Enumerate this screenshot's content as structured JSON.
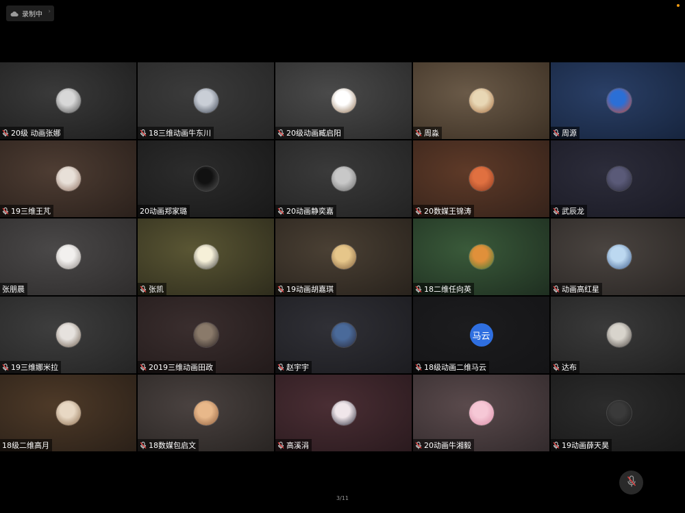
{
  "recording": {
    "label": "录制中",
    "icon": "cloud-icon"
  },
  "status_dot_color": "#f39c12",
  "page_indicator": "3/11",
  "mic_button": {
    "icon": "mic-muted-icon"
  },
  "participants": [
    {
      "name": "20级 动画张娜",
      "muted": true,
      "bg": [
        "#3a3a3a",
        "#1e1e1e"
      ],
      "avatar": [
        "#d8d8d8",
        "#4a4a4a"
      ]
    },
    {
      "name": "18三维动画牛东川",
      "muted": true,
      "bg": [
        "#3b3b3b",
        "#262626"
      ],
      "avatar": [
        "#c9ced6",
        "#3a4250"
      ]
    },
    {
      "name": "20级动画臧启阳",
      "muted": true,
      "bg": [
        "#4a4a4a",
        "#2a2a2a"
      ],
      "avatar": [
        "#ffffff",
        "#8a6a4a"
      ]
    },
    {
      "name": "周淼",
      "muted": true,
      "bg": [
        "#6a5a48",
        "#3c3024"
      ],
      "avatar": [
        "#e8d7b5",
        "#a36a3c"
      ]
    },
    {
      "name": "周源",
      "muted": true,
      "bg": [
        "#2a3f66",
        "#16243d"
      ],
      "avatar": [
        "#2b6fd6",
        "#d44a2b"
      ]
    },
    {
      "name": "19三维王芃",
      "muted": true,
      "bg": [
        "#4e3d33",
        "#2a201b"
      ],
      "avatar": [
        "#e8e0d8",
        "#8a6a5a"
      ]
    },
    {
      "name": "20动画郑家璐",
      "muted": false,
      "bg": [
        "#2c2c2c",
        "#181818"
      ],
      "avatar": [
        "#111111",
        "#555555"
      ]
    },
    {
      "name": "20动画静奕嘉",
      "muted": true,
      "bg": [
        "#3a3a3a",
        "#222222"
      ],
      "avatar": [
        "#c8c8c8",
        "#666666"
      ]
    },
    {
      "name": "20数媒王锦涛",
      "muted": true,
      "bg": [
        "#5e3a28",
        "#34221a"
      ],
      "avatar": [
        "#e07040",
        "#8a3a20"
      ]
    },
    {
      "name": "武辰龙",
      "muted": true,
      "bg": [
        "#2c2c3a",
        "#1a1a24"
      ],
      "avatar": [
        "#5a5a78",
        "#2c2c3c"
      ]
    },
    {
      "name": "张朋晨",
      "muted": false,
      "bg": [
        "#4a4848",
        "#2e2c2c"
      ],
      "avatar": [
        "#f2f0ee",
        "#8a8480"
      ]
    },
    {
      "name": "张凯",
      "muted": true,
      "bg": [
        "#5a5634",
        "#2e2c1c"
      ],
      "avatar": [
        "#f6f0d8",
        "#3a3a3a"
      ]
    },
    {
      "name": "19动画胡嘉琪",
      "muted": true,
      "bg": [
        "#4a4034",
        "#28221c"
      ],
      "avatar": [
        "#e6c68a",
        "#7a5a3a"
      ]
    },
    {
      "name": "18二维任向英",
      "muted": true,
      "bg": [
        "#3a5a3a",
        "#1e2e20"
      ],
      "avatar": [
        "#e0903a",
        "#3a7a3a"
      ]
    },
    {
      "name": "动画高红星",
      "muted": true,
      "bg": [
        "#4a4440",
        "#2a2624"
      ],
      "avatar": [
        "#bcd8f0",
        "#3a5a8a"
      ]
    },
    {
      "name": "19三维娜米拉",
      "muted": true,
      "bg": [
        "#3e3e3e",
        "#242424"
      ],
      "avatar": [
        "#e6e2de",
        "#6a5a4a"
      ]
    },
    {
      "name": "2019三维动画田政",
      "muted": true,
      "bg": [
        "#3a2e2e",
        "#221a1a"
      ],
      "avatar": [
        "#8a7a6a",
        "#2a2222"
      ]
    },
    {
      "name": "赵宇宇",
      "muted": true,
      "bg": [
        "#303036",
        "#1c1c20"
      ],
      "avatar": [
        "#4a6a9a",
        "#2a2a3a"
      ]
    },
    {
      "name": "18级动画二维马云",
      "muted": true,
      "bg": [
        "#1c1c1e",
        "#141416"
      ],
      "avatar_text": "马云",
      "avatar_color": "#2f6fe0"
    },
    {
      "name": "达布",
      "muted": true,
      "bg": [
        "#3a3a3a",
        "#202020"
      ],
      "avatar": [
        "#d8d4cc",
        "#4a4440"
      ]
    },
    {
      "name": "18级二维高月",
      "muted": false,
      "bg": [
        "#4e3a28",
        "#2a2018"
      ],
      "avatar": [
        "#e8d8c4",
        "#8a6a4a"
      ]
    },
    {
      "name": "18数媒包启文",
      "muted": true,
      "bg": [
        "#4a4240",
        "#282422"
      ],
      "avatar": [
        "#e8b88a",
        "#8a5a3a"
      ]
    },
    {
      "name": "高溪涓",
      "muted": true,
      "bg": [
        "#4a2e34",
        "#2a1a1e"
      ],
      "avatar": [
        "#f0e6ea",
        "#2a2a3a"
      ]
    },
    {
      "name": "20动画牛湘毅",
      "muted": true,
      "bg": [
        "#5a4a4c",
        "#322a2c"
      ],
      "avatar": [
        "#f6c8d6",
        "#d88aa4"
      ]
    },
    {
      "name": "19动画薛天昊",
      "muted": true,
      "bg": [
        "#2c2c2c",
        "#181818"
      ],
      "avatar": [
        "#3a3a3a",
        "#1a1a1a"
      ]
    }
  ]
}
